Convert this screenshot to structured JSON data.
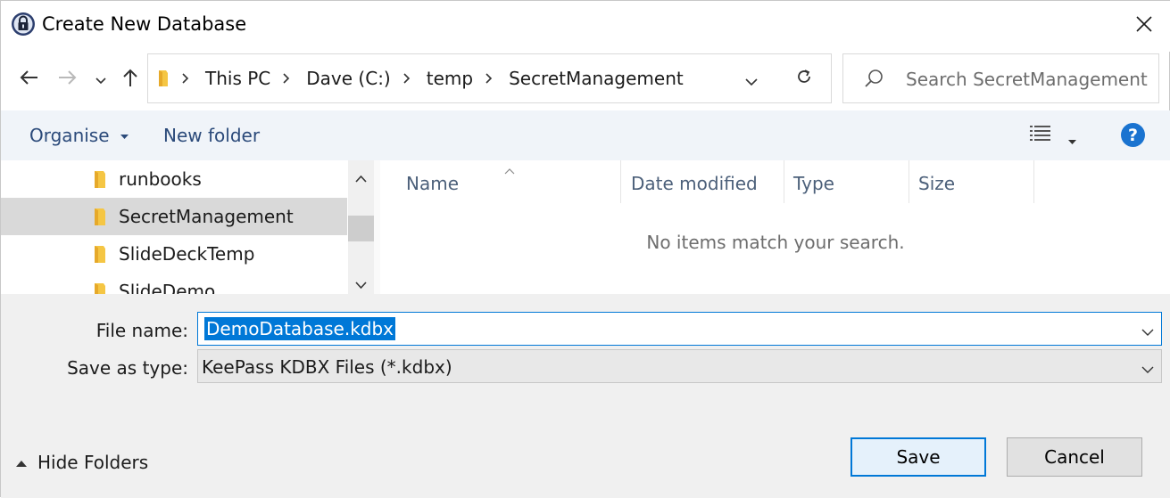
{
  "window": {
    "title": "Create New Database"
  },
  "address": {
    "breadcrumb": [
      "This PC",
      "Dave (C:)",
      "temp",
      "SecretManagement"
    ]
  },
  "search": {
    "placeholder": "Search SecretManagement"
  },
  "toolbar": {
    "organise_label": "Organise",
    "new_folder_label": "New folder",
    "help_label": "?"
  },
  "nav_pane": {
    "items": [
      {
        "label": "runbooks",
        "selected": false
      },
      {
        "label": "SecretManagement",
        "selected": true
      },
      {
        "label": "SlideDeckTemp",
        "selected": false
      },
      {
        "label": "SlideDemo",
        "selected": false
      }
    ]
  },
  "file_list": {
    "columns": [
      "Name",
      "Date modified",
      "Type",
      "Size"
    ],
    "sort_column": "Name",
    "empty_message": "No items match your search."
  },
  "form": {
    "file_name_label": "File name:",
    "file_name_value": "DemoDatabase.kdbx",
    "save_type_label": "Save as type:",
    "save_type_value": "KeePass KDBX Files (*.kdbx)"
  },
  "footer": {
    "hide_folders_label": "Hide Folders",
    "save_label": "Save",
    "cancel_label": "Cancel"
  },
  "colors": {
    "accent": "#0078d7",
    "toolbar_bg": "#f0f4f9",
    "bottom_bg": "#f0f0f0",
    "selected_row": "#d9d9d9",
    "folder": "#f5c644"
  },
  "icons": {
    "app": "keepass-lock-icon",
    "close": "close-icon",
    "back": "back-arrow-icon",
    "forward": "forward-arrow-icon",
    "recent": "chevron-down-icon",
    "up": "up-arrow-icon",
    "refresh": "refresh-icon",
    "search": "search-icon",
    "view": "view-details-icon",
    "folder": "folder-icon"
  }
}
